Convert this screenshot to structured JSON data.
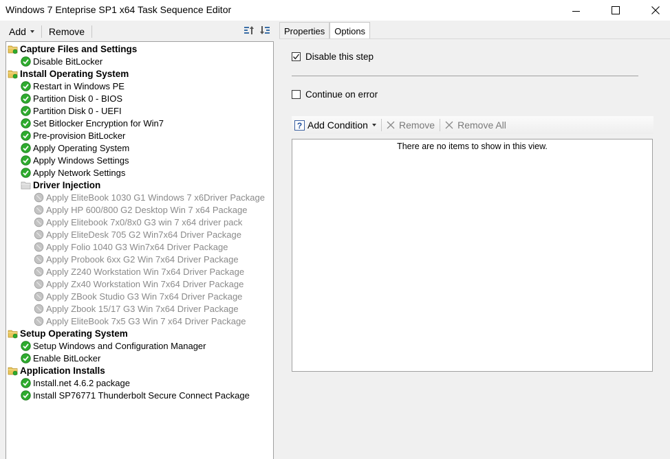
{
  "window": {
    "title": "Windows 7 Enteprise SP1 x64 Task Sequence Editor"
  },
  "toolbar": {
    "add_label": "Add",
    "remove_label": "Remove"
  },
  "tree": {
    "items": [
      {
        "label": "Capture Files and Settings",
        "type": "group",
        "level": 0,
        "icon": "folder-icon"
      },
      {
        "label": "Disable BitLocker",
        "type": "step",
        "level": 1,
        "icon": "check-icon"
      },
      {
        "label": "Install Operating System",
        "type": "group",
        "level": 0,
        "icon": "folder-icon"
      },
      {
        "label": "Restart in Windows PE",
        "type": "step",
        "level": 1,
        "icon": "check-icon"
      },
      {
        "label": "Partition Disk 0 - BIOS",
        "type": "step",
        "level": 1,
        "icon": "check-icon"
      },
      {
        "label": "Partition Disk 0 - UEFI",
        "type": "step",
        "level": 1,
        "icon": "check-icon"
      },
      {
        "label": "Set Bitlocker Encryption for Win7",
        "type": "step",
        "level": 1,
        "icon": "check-icon"
      },
      {
        "label": "Pre-provision BitLocker",
        "type": "step",
        "level": 1,
        "icon": "check-icon"
      },
      {
        "label": "Apply Operating System",
        "type": "step",
        "level": 1,
        "icon": "check-icon"
      },
      {
        "label": "Apply Windows Settings",
        "type": "step",
        "level": 1,
        "icon": "check-icon"
      },
      {
        "label": "Apply Network Settings",
        "type": "step",
        "level": 1,
        "icon": "check-icon"
      },
      {
        "label": "Driver Injection",
        "type": "group-disabled",
        "level": 1,
        "icon": "folder-disabled-icon"
      },
      {
        "label": "Apply EliteBook 1030 G1 Windows 7 x6Driver Package",
        "type": "disabled",
        "level": 2,
        "icon": "disabled-step-icon"
      },
      {
        "label": "Apply HP 600/800 G2 Desktop Win 7 x64 Package",
        "type": "disabled",
        "level": 2,
        "icon": "disabled-step-icon"
      },
      {
        "label": "Apply Elitebook 7x0/8x0 G3 win 7 x64 driver pack",
        "type": "disabled",
        "level": 2,
        "icon": "disabled-step-icon"
      },
      {
        "label": "Apply EliteDesk 705 G2 Win7x64 Driver Package",
        "type": "disabled",
        "level": 2,
        "icon": "disabled-step-icon"
      },
      {
        "label": "Apply Folio 1040 G3 Win7x64 Driver Package",
        "type": "disabled",
        "level": 2,
        "icon": "disabled-step-icon"
      },
      {
        "label": "Apply Probook 6xx G2 Win 7x64 Driver Package",
        "type": "disabled",
        "level": 2,
        "icon": "disabled-step-icon"
      },
      {
        "label": "Apply Z240 Workstation Win 7x64 Driver Package",
        "type": "disabled",
        "level": 2,
        "icon": "disabled-step-icon"
      },
      {
        "label": "Apply Zx40 Workstation Win 7x64 Driver Package",
        "type": "disabled",
        "level": 2,
        "icon": "disabled-step-icon"
      },
      {
        "label": "Apply ZBook Studio G3 Win 7x64 Driver Package",
        "type": "disabled",
        "level": 2,
        "icon": "disabled-step-icon"
      },
      {
        "label": "Apply Zbook 15/17 G3 Win 7x64 Driver Package",
        "type": "disabled",
        "level": 2,
        "icon": "disabled-step-icon"
      },
      {
        "label": "Apply EliteBook 7x5 G3 Win 7 x64 Driver Package",
        "type": "disabled",
        "level": 2,
        "icon": "disabled-step-icon"
      },
      {
        "label": "Setup Operating System",
        "type": "group",
        "level": 0,
        "icon": "folder-icon"
      },
      {
        "label": "Setup Windows and Configuration Manager",
        "type": "step",
        "level": 1,
        "icon": "check-icon"
      },
      {
        "label": "Enable BitLocker",
        "type": "step",
        "level": 1,
        "icon": "check-icon"
      },
      {
        "label": "Application Installs",
        "type": "group",
        "level": 0,
        "icon": "folder-icon"
      },
      {
        "label": "Install.net 4.6.2 package",
        "type": "step",
        "level": 1,
        "icon": "check-icon"
      },
      {
        "label": "Install SP76771 Thunderbolt Secure Connect Package",
        "type": "step",
        "level": 1,
        "icon": "check-icon"
      }
    ]
  },
  "tabs": [
    {
      "label": "Properties",
      "active": false
    },
    {
      "label": "Options",
      "active": true
    }
  ],
  "options": {
    "disable_step_label": "Disable this step",
    "disable_step_checked": true,
    "continue_on_error_label": "Continue on error",
    "continue_on_error_checked": false
  },
  "conditions": {
    "add_label": "Add Condition",
    "remove_label": "Remove",
    "remove_all_label": "Remove All",
    "empty_text": "There are no items to show in this view."
  },
  "colors": {
    "check_green": "#2eab2e",
    "folder_yellow": "#e8c659",
    "disabled_text": "#8a8a8a"
  }
}
